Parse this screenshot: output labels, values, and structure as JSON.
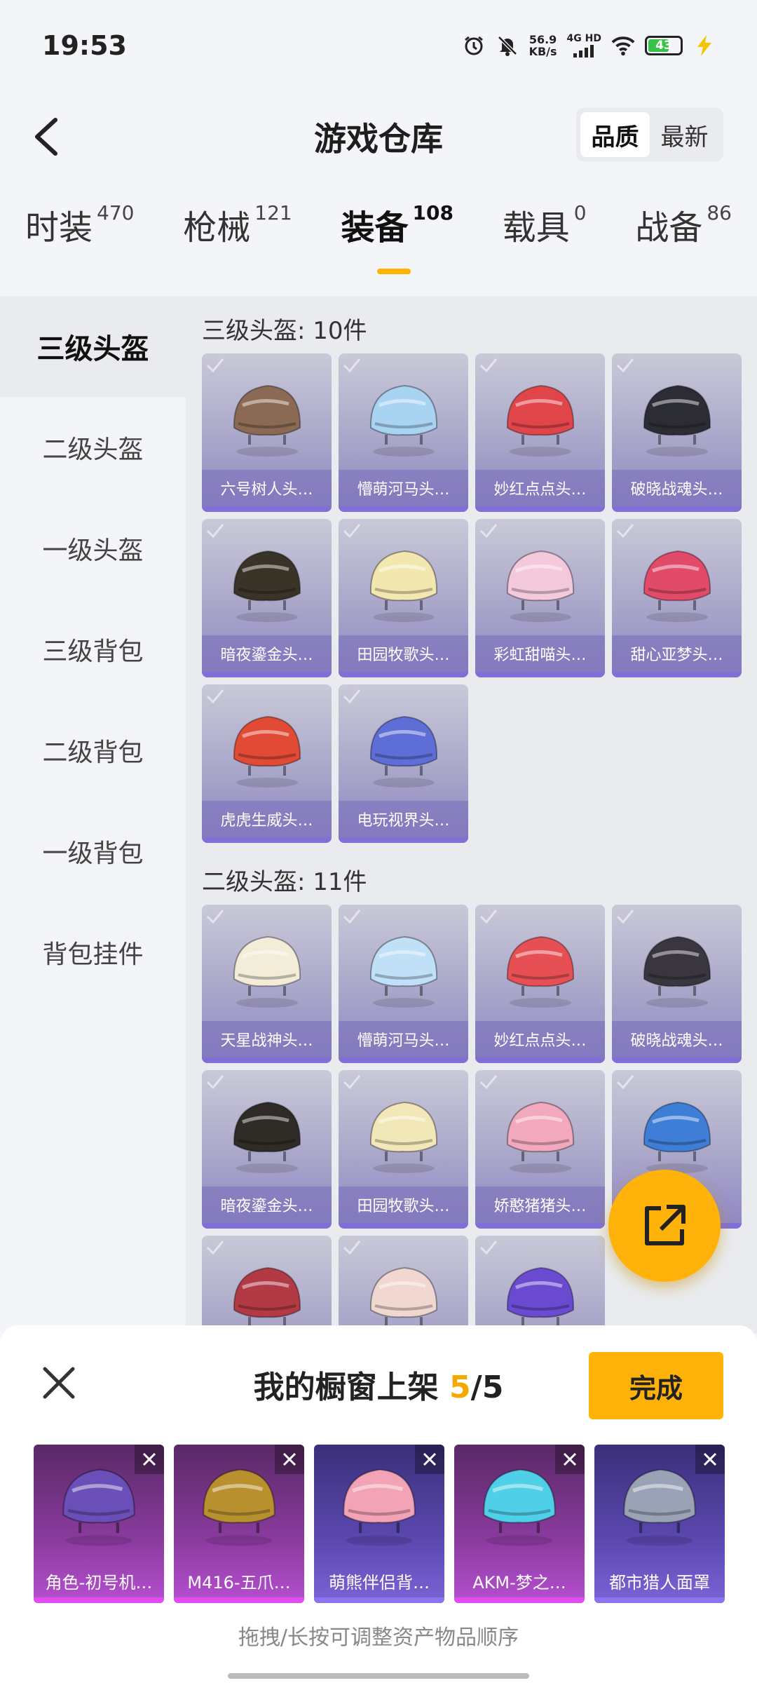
{
  "status_bar": {
    "time": "19:53",
    "net_speed_value": "56.9",
    "net_speed_unit": "KB/s",
    "network_type": "4G HD",
    "battery_level": "43"
  },
  "header": {
    "title": "游戏仓库",
    "sort_options": [
      "品质",
      "最新"
    ],
    "sort_active": "品质"
  },
  "tabs": [
    {
      "label": "时装",
      "count": "470"
    },
    {
      "label": "枪械",
      "count": "121"
    },
    {
      "label": "装备",
      "count": "108",
      "active": true
    },
    {
      "label": "载具",
      "count": "0"
    },
    {
      "label": "战备",
      "count": "86"
    }
  ],
  "sidebar": {
    "items": [
      "三级头盔",
      "二级头盔",
      "一级头盔",
      "三级背包",
      "二级背包",
      "一级背包",
      "背包挂件"
    ],
    "active": "三级头盔"
  },
  "sections": [
    {
      "title": "三级头盔: 10件",
      "items": [
        {
          "name": "六号树人头…",
          "color": "#8a6a55"
        },
        {
          "name": "懵萌河马头…",
          "color": "#a8d4f2"
        },
        {
          "name": "妙红点点头…",
          "color": "#e0454a"
        },
        {
          "name": "破晓战魂头…",
          "color": "#2c2c35"
        },
        {
          "name": "暗夜鎏金头…",
          "color": "#3a3328"
        },
        {
          "name": "田园牧歌头…",
          "color": "#f3e7b0"
        },
        {
          "name": "彩虹甜喵头…",
          "color": "#f4c9dc"
        },
        {
          "name": "甜心亚梦头…",
          "color": "#e24a6a"
        },
        {
          "name": "虎虎生威头…",
          "color": "#e14a35"
        },
        {
          "name": "电玩视界头…",
          "color": "#5d6fd6"
        }
      ]
    },
    {
      "title": "二级头盔: 11件",
      "items": [
        {
          "name": "天星战神头…",
          "color": "#f2ecd8"
        },
        {
          "name": "懵萌河马头…",
          "color": "#bfe0f7"
        },
        {
          "name": "妙红点点头…",
          "color": "#e65054"
        },
        {
          "name": "破晓战魂头…",
          "color": "#3a3640"
        },
        {
          "name": "暗夜鎏金头…",
          "color": "#2f2b26"
        },
        {
          "name": "田园牧歌头…",
          "color": "#f2e7b8"
        },
        {
          "name": "娇憨猪猪头…",
          "color": "#f2a9bd"
        },
        {
          "name": "",
          "color": "#3f7ed6"
        },
        {
          "name": "",
          "color": "#b23a44"
        },
        {
          "name": "",
          "color": "#f0d7d0"
        },
        {
          "name": "",
          "color": "#6a4bd0"
        }
      ]
    }
  ],
  "showcase": {
    "title_prefix": "我的橱窗上架 ",
    "count_current": "5",
    "count_sep": "/",
    "count_total": "5",
    "done_label": "完成",
    "hint": "拖拽/长按可调整资产物品顺序",
    "items": [
      {
        "name": "角色-初号机…",
        "tier": "purple",
        "color": "#6b4fb8"
      },
      {
        "name": "M416-五爪…",
        "tier": "purple",
        "color": "#b8902e"
      },
      {
        "name": "萌熊伴侣背…",
        "tier": "violet",
        "color": "#f2a3b6"
      },
      {
        "name": "AKM-梦之…",
        "tier": "purple",
        "color": "#4fd0e8"
      },
      {
        "name": "都市猎人面罩",
        "tier": "violet",
        "color": "#9aa3b5"
      }
    ]
  }
}
